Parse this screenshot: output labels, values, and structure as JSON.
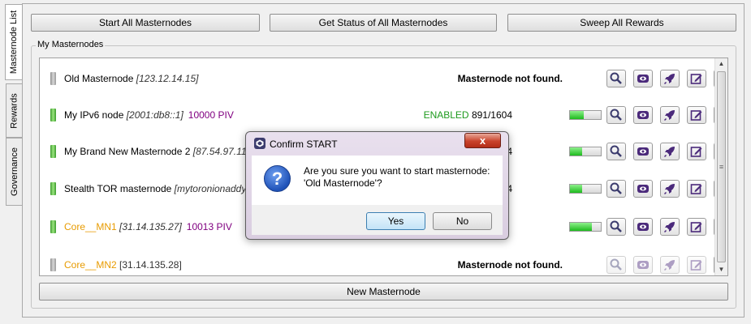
{
  "tabs": [
    {
      "label": "Masternode List"
    },
    {
      "label": "Rewards"
    },
    {
      "label": "Governance"
    }
  ],
  "top_buttons": {
    "start_all": "Start All Masternodes",
    "get_status": "Get Status of All Masternodes",
    "sweep": "Sweep All Rewards"
  },
  "group_title": "My Masternodes",
  "rows": [
    {
      "name": "Old Masternode",
      "addr": "[123.12.14.15]",
      "piv": "",
      "status": "Masternode not found.",
      "led": "gray"
    },
    {
      "name": "My IPv6 node",
      "addr": "[2001:db8::1]",
      "piv": "10000 PIV",
      "status": "ENABLED",
      "progress_text": "891/1604",
      "progress": 0.55,
      "led": "green"
    },
    {
      "name": "My Brand New Masternode 2",
      "addr": "[87.54.97.111",
      "piv": "",
      "status": "",
      "progress_text": "604",
      "progress": 0.5,
      "led": "green"
    },
    {
      "name": "Stealth TOR masternode",
      "addr": "[mytoronionaddy.",
      "piv": "",
      "status": "",
      "progress_text": "604",
      "progress": 0.5,
      "led": "green"
    },
    {
      "name": "Core__MN1",
      "addr": "[31.14.135.27]",
      "piv": "10013 PIV",
      "status": "",
      "progress_text": "",
      "progress": 0.7,
      "led": "green"
    },
    {
      "name": "Core__MN2",
      "addr": "[31.14.135.28]",
      "piv": "",
      "status": "Masternode not found.",
      "led": "gray"
    }
  ],
  "new_button": "New Masternode",
  "dialog": {
    "title": "Confirm START",
    "close": "x",
    "question_mark": "?",
    "message_line1": "Are you sure you want to start masternode:",
    "message_line2": "'Old Masternode'?",
    "yes": "Yes",
    "no": "No"
  },
  "colors": {
    "accent_purple": "#5b2a86",
    "enabled_green": "#1e9b1e",
    "piv_purple": "#800080",
    "core_orange": "#e89b00"
  },
  "icons": [
    "search-icon",
    "eye-icon",
    "rocket-icon",
    "edit-icon",
    "trash-icon",
    "more-vertical-icon",
    "question-icon"
  ]
}
